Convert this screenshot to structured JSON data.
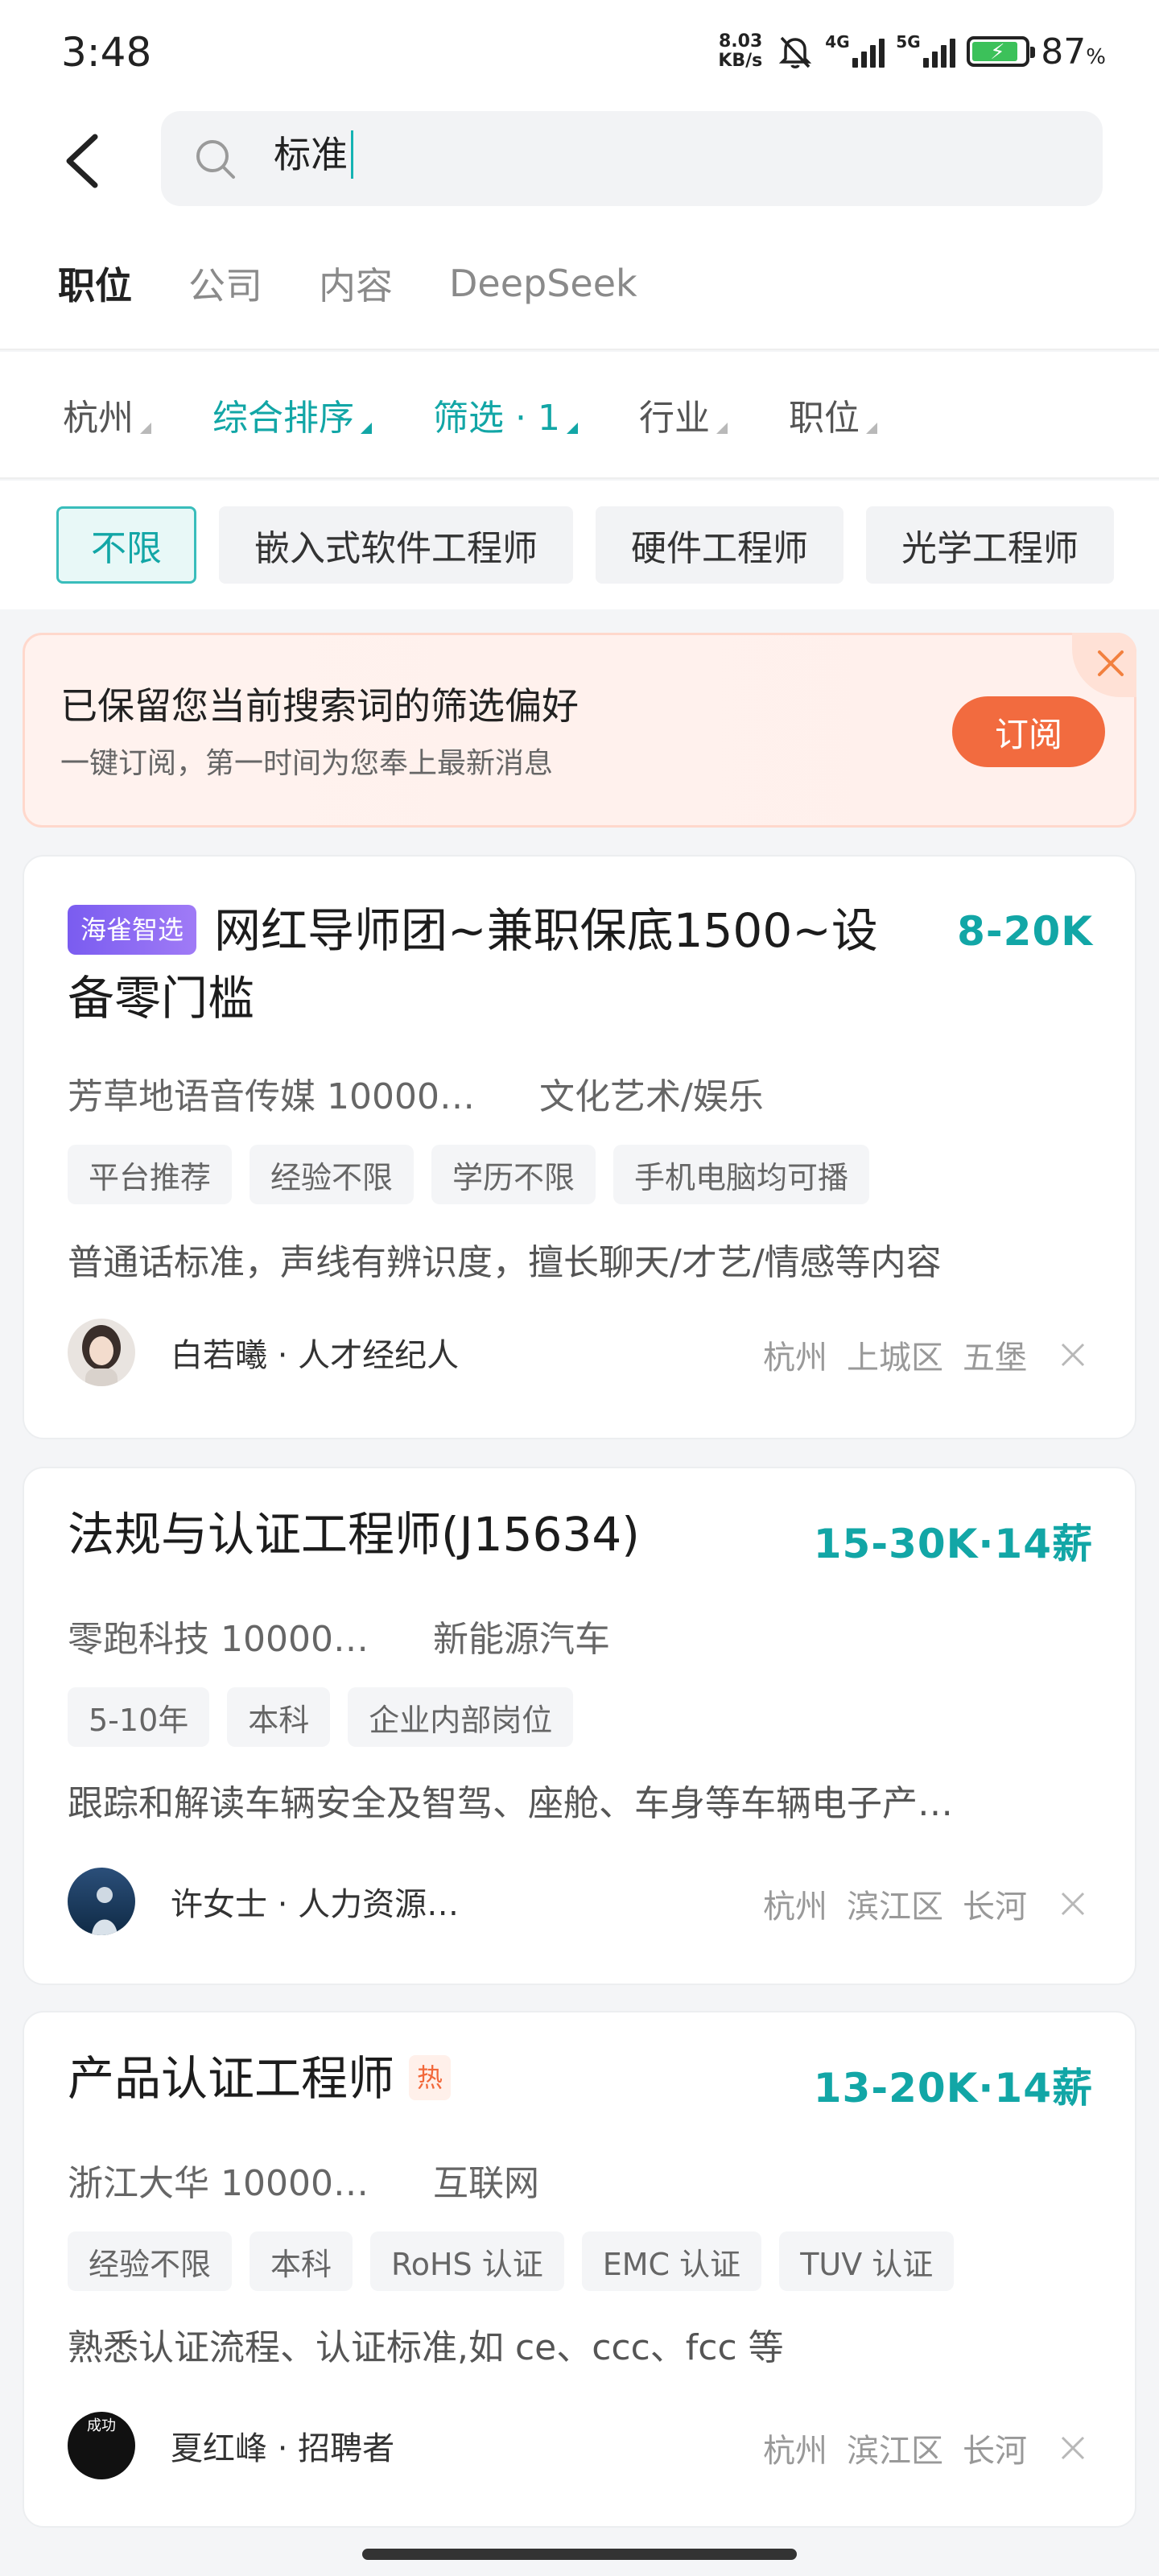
{
  "status": {
    "time": "3:48",
    "net_speed_value": "8.03",
    "net_speed_unit": "KB/s",
    "sim1": "4G",
    "sim2": "5G",
    "battery_percent": "87",
    "battery_unit": "%",
    "battery_level": 0.87
  },
  "search": {
    "query": "标准"
  },
  "tabs": [
    {
      "label": "职位",
      "active": true
    },
    {
      "label": "公司",
      "active": false
    },
    {
      "label": "内容",
      "active": false
    },
    {
      "label": "DeepSeek",
      "active": false
    }
  ],
  "filters": [
    {
      "label": "杭州",
      "highlighted": false
    },
    {
      "label": "综合排序",
      "highlighted": true
    },
    {
      "label": "筛选 · 1",
      "highlighted": true
    },
    {
      "label": "行业",
      "highlighted": false
    },
    {
      "label": "职位",
      "highlighted": false
    }
  ],
  "chips": [
    {
      "label": "不限",
      "active": true
    },
    {
      "label": "嵌入式软件工程师",
      "active": false
    },
    {
      "label": "硬件工程师",
      "active": false
    },
    {
      "label": "光学工程师",
      "active": false
    }
  ],
  "subscribe": {
    "title": "已保留您当前搜索词的筛选偏好",
    "desc": "一键订阅，第一时间为您奉上最新消息",
    "button": "订阅"
  },
  "jobs": [
    {
      "badge": "海雀智选",
      "title": "网红导师团~兼职保底1500~设备零门槛",
      "salary": "8-20K",
      "company": "芳草地语音传媒  10000…",
      "industry": "文化艺术/娱乐",
      "tags": [
        "平台推荐",
        "经验不限",
        "学历不限",
        "手机电脑均可播"
      ],
      "desc": "普通话标准，声线有辨识度，擅长聊天/才艺/情感等内容",
      "recruiter": "白若曦 · 人才经纪人",
      "location": [
        "杭州",
        "上城区",
        "五堡"
      ]
    },
    {
      "title": "法规与认证工程师(J15634)",
      "salary": "15-30K·14薪",
      "company": "零跑科技  10000…",
      "industry": "新能源汽车",
      "tags": [
        "5-10年",
        "本科",
        "企业内部岗位"
      ],
      "desc": "跟踪和解读车辆安全及智驾、座舱、车身等车辆电子产…",
      "recruiter": "许女士 · 人力资源…",
      "location": [
        "杭州",
        "滨江区",
        "长河"
      ]
    },
    {
      "title": "产品认证工程师",
      "hot": "热",
      "salary": "13-20K·14薪",
      "company": "浙江大华  10000…",
      "industry": "互联网",
      "tags": [
        "经验不限",
        "本科",
        "RoHS 认证",
        "EMC 认证",
        "TUV 认证"
      ],
      "desc": "熟悉认证流程、认证标准,如 ce、ccc、fcc 等",
      "recruiter": "夏红峰 · 招聘者",
      "avatar_text": "成功",
      "location": [
        "杭州",
        "滨江区",
        "长河"
      ]
    }
  ]
}
